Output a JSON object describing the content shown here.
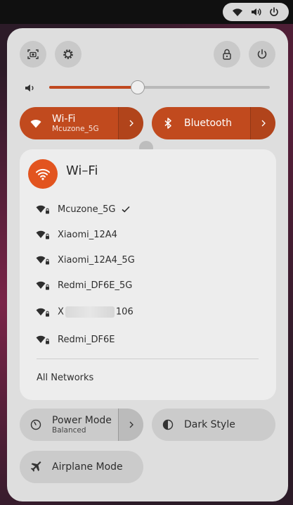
{
  "topbar": {
    "tray_icons": [
      "wifi-icon",
      "speaker-icon",
      "power-icon"
    ]
  },
  "quick_settings": {
    "header_buttons": {
      "screenshot": "screenshot-icon",
      "settings": "gear-icon",
      "lock": "lock-icon",
      "power": "power-icon"
    },
    "volume": {
      "icon": "speaker-icon",
      "level": 0.4
    },
    "wifi_toggle": {
      "title": "Wi-Fi",
      "subtitle": "Mcuzone_5G",
      "active": true
    },
    "bluetooth_toggle": {
      "title": "Bluetooth",
      "active": true
    },
    "wifi_menu": {
      "title": "Wi–Fi",
      "networks": [
        {
          "name": "Mcuzone_5G",
          "connected": true
        },
        {
          "name": "Xiaomi_12A4",
          "connected": false
        },
        {
          "name": "Xiaomi_12A4_5G",
          "connected": false
        },
        {
          "name": "Redmi_DF6E_5G",
          "connected": false
        },
        {
          "name_prefix": "X",
          "name_suffix": "106",
          "connected": false
        },
        {
          "name": "Redmi_DF6E",
          "connected": false
        }
      ],
      "all_networks_label": "All Networks"
    },
    "power_mode": {
      "title": "Power Mode",
      "subtitle": "Balanced"
    },
    "dark_style": {
      "title": "Dark Style"
    },
    "airplane_mode": {
      "title": "Airplane Mode"
    }
  },
  "colors": {
    "accent": "#c14a1e",
    "accent_bright": "#e2541f",
    "panel": "#dedede",
    "popup": "#ededed",
    "tile": "#cbcbcb"
  }
}
